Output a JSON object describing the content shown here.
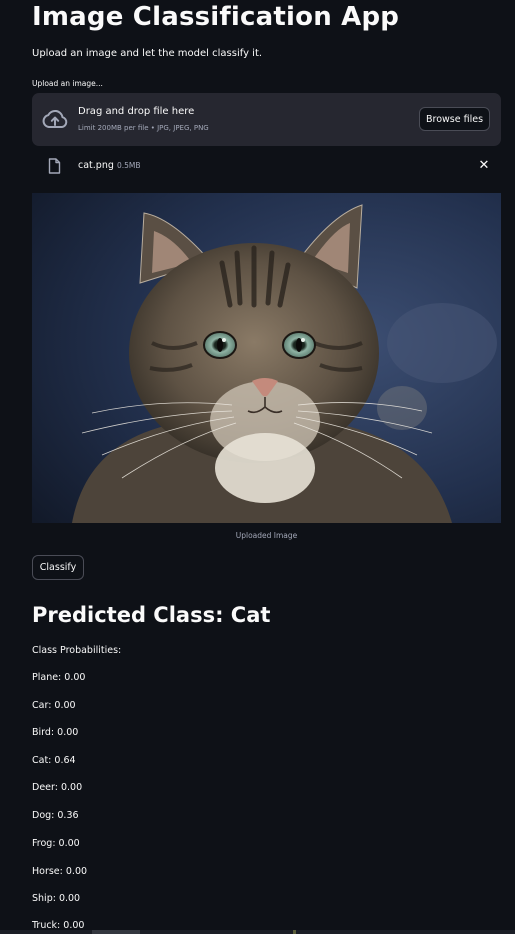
{
  "app": {
    "title": "Image Classification App",
    "subtitle": "Upload an image and let the model classify it."
  },
  "uploader": {
    "label": "Upload an image...",
    "drop_title": "Drag and drop file here",
    "drop_hint": "Limit 200MB per file • JPG, JPEG, PNG",
    "browse_label": "Browse files",
    "icon": "cloud-upload-icon"
  },
  "uploaded_file": {
    "name": "cat.png",
    "size": "0.5MB",
    "icon": "file-icon",
    "remove_symbol": "✕"
  },
  "image": {
    "caption": "Uploaded Image"
  },
  "classify": {
    "label": "Classify"
  },
  "result": {
    "predicted": "Predicted Class: Cat",
    "probabilities_heading": "Class Probabilities:",
    "probabilities": [
      "Plane: 0.00",
      "Car: 0.00",
      "Bird: 0.00",
      "Cat: 0.64",
      "Deer: 0.00",
      "Dog: 0.36",
      "Frog: 0.00",
      "Horse: 0.00",
      "Ship: 0.00",
      "Truck: 0.00"
    ]
  },
  "colors": {
    "background": "#0e1117",
    "surface": "#262730",
    "text": "#fafafa",
    "muted": "#a3a8b8"
  }
}
